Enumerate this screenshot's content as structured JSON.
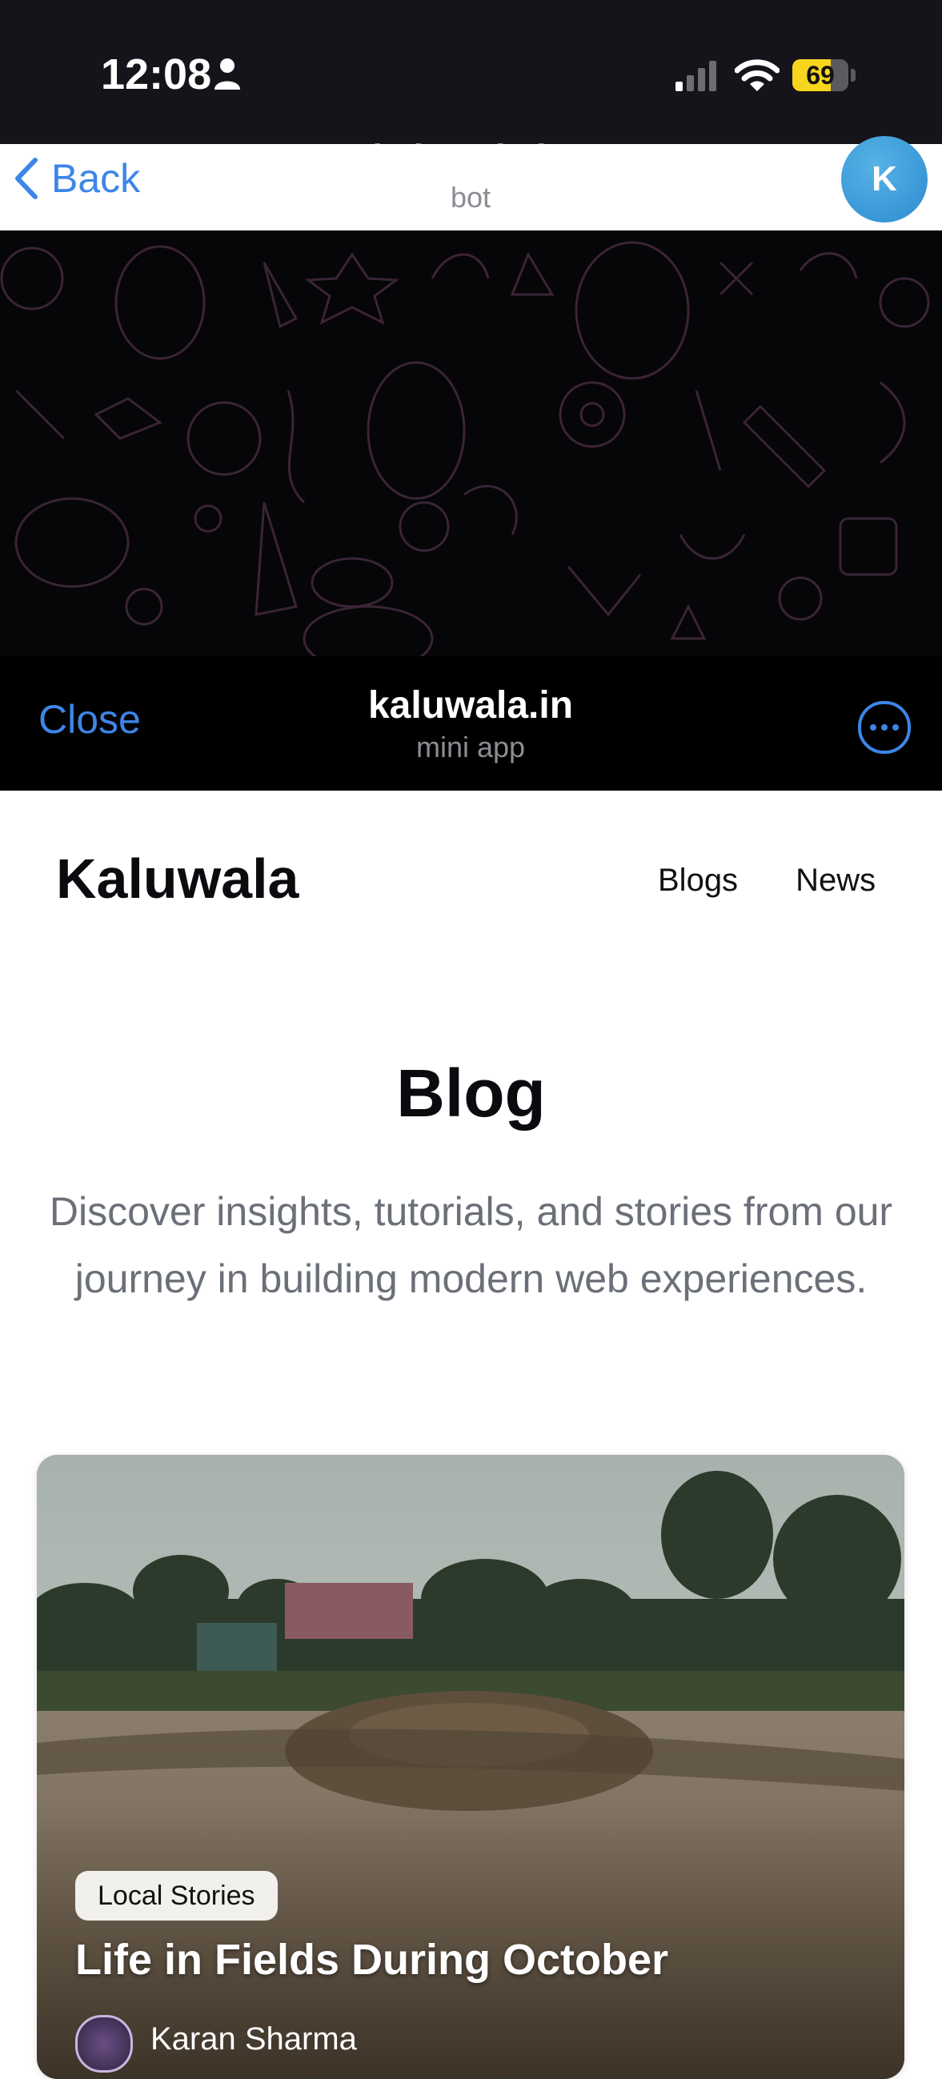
{
  "status_bar": {
    "time": "12:08",
    "battery": "69",
    "battery_level": 0.69
  },
  "chat_header": {
    "back_label": "Back",
    "title": "kaluwala.in",
    "subtitle": "bot",
    "avatar_letter": "K"
  },
  "mini_app_header": {
    "close_label": "Close",
    "title": "kaluwala.in",
    "subtitle": "mini app"
  },
  "site": {
    "logo": "Kaluwala",
    "nav": [
      {
        "label": "Blogs"
      },
      {
        "label": "News"
      }
    ],
    "heading": "Blog",
    "description": "Discover insights, tutorials, and stories from our journey in building modern web experiences."
  },
  "posts": [
    {
      "category": "Local Stories",
      "title": "Life in Fields During October",
      "author": "Karan Sharma"
    }
  ],
  "colors": {
    "accent": "#3d86e8",
    "battery": "#f7d51c",
    "avatar": "#2d8bd0"
  },
  "icons": [
    "person-icon",
    "signal-icon",
    "wifi-icon",
    "battery-icon",
    "chevron-left-icon",
    "more-icon"
  ]
}
